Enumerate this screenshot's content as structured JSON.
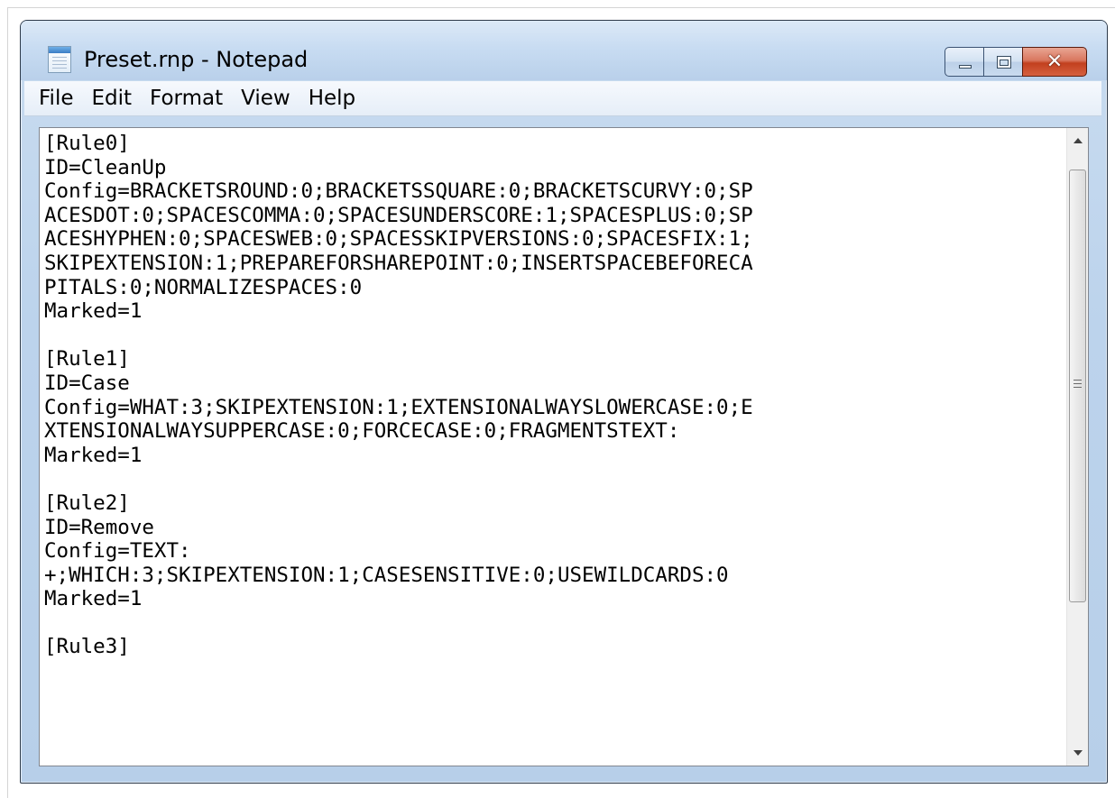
{
  "window": {
    "title": "Preset.rnp - Notepad",
    "icon": "notepad-icon"
  },
  "caption_buttons": {
    "minimize_icon": "minimize-icon",
    "maximize_icon": "maximize-icon",
    "close_icon": "close-icon",
    "close_glyph": "✕",
    "close_color": "#c2401f"
  },
  "menubar": {
    "items": [
      "File",
      "Edit",
      "Format",
      "View",
      "Help"
    ]
  },
  "editor": {
    "lines": [
      "[Rule0]",
      "ID=CleanUp",
      "Config=BRACKETSROUND:0;BRACKETSSQUARE:0;BRACKETSCURVY:0;SP",
      "ACESDOT:0;SPACESCOMMA:0;SPACESUNDERSCORE:1;SPACESPLUS:0;SP",
      "ACESHYPHEN:0;SPACESWEB:0;SPACESSKIPVERSIONS:0;SPACESFIX:1;",
      "SKIPEXTENSION:1;PREPAREFORSHAREPOINT:0;INSERTSPACEBEFORECA",
      "PITALS:0;NORMALIZESPACES:0",
      "Marked=1",
      "",
      "[Rule1]",
      "ID=Case",
      "Config=WHAT:3;SKIPEXTENSION:1;EXTENSIONALWAYSLOWERCASE:0;E",
      "XTENSIONALWAYSUPPERCASE:0;FORCECASE:0;FRAGMENTSTEXT:",
      "Marked=1",
      "",
      "[Rule2]",
      "ID=Remove",
      "Config=TEXT:",
      "+;WHICH:3;SKIPEXTENSION:1;CASESENSITIVE:0;USEWILDCARDS:0",
      "Marked=1",
      "",
      "[Rule3]"
    ]
  },
  "scrollbar": {
    "up_icon": "scroll-up-arrow-icon",
    "down_icon": "scroll-down-arrow-icon",
    "position_fraction": 0.0
  }
}
